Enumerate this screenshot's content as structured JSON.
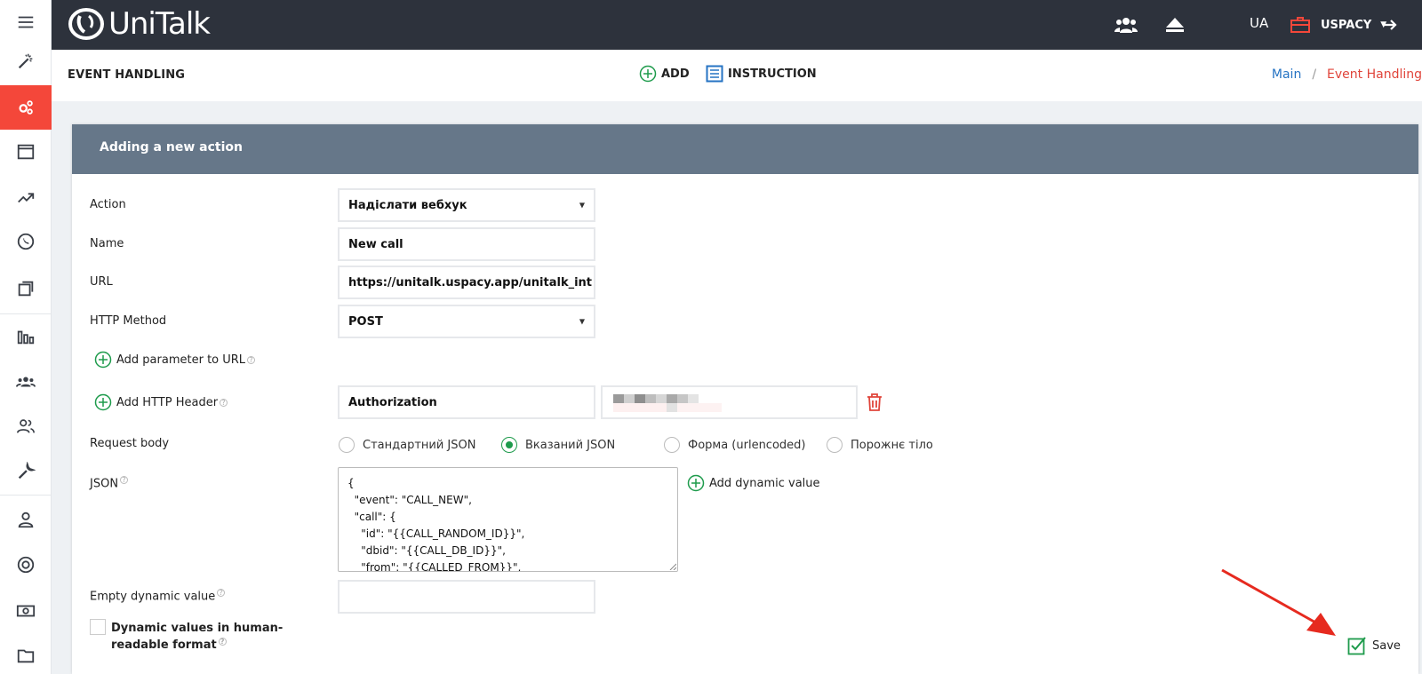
{
  "app": {
    "logo_text": "UniTalk"
  },
  "topbar": {
    "language": "UA",
    "organization": "USPACY"
  },
  "header": {
    "title": "EVENT HANDLING",
    "add_label": "ADD",
    "instruction_label": "INSTRUCTION",
    "breadcrumb": {
      "main": "Main",
      "separator": "/",
      "current": "Event Handling"
    }
  },
  "sidebar": {
    "items": [
      {
        "icon": "menu-icon"
      },
      {
        "icon": "magic-wand-icon"
      },
      {
        "icon": "gears-icon",
        "active": true
      },
      {
        "icon": "window-icon"
      },
      {
        "icon": "trend-icon"
      },
      {
        "icon": "phone-icon"
      },
      {
        "icon": "copy-icon"
      },
      {
        "icon": "bar-chart-icon"
      },
      {
        "icon": "group-icon"
      },
      {
        "icon": "users-icon"
      },
      {
        "icon": "wrench-icon"
      },
      {
        "icon": "user-icon"
      },
      {
        "icon": "lifebuoy-icon"
      },
      {
        "icon": "money-icon"
      },
      {
        "icon": "folder-icon"
      }
    ]
  },
  "card": {
    "title": "Adding a new action",
    "action": {
      "label": "Action",
      "value": "Надіслати вебхук"
    },
    "name": {
      "label": "Name",
      "value": "New call"
    },
    "url": {
      "label": "URL",
      "value": "https://unitalk.uspacy.app/unitalk_int"
    },
    "http_method": {
      "label": "HTTP Method",
      "value": "POST"
    },
    "add_param_label": "Add parameter to URL",
    "add_header_label": "Add HTTP Header",
    "header_key": "Authorization",
    "request_body": {
      "label": "Request body",
      "options": [
        "Стандартний JSON",
        "Вказаний JSON",
        "Форма (urlencoded)",
        "Порожнє тіло"
      ],
      "selected": "Вказаний JSON"
    },
    "json": {
      "label": "JSON",
      "value": "{\n  \"event\": \"CALL_NEW\",\n  \"call\": {\n    \"id\": \"{{CALL_RANDOM_ID}}\",\n    \"dbid\": \"{{CALL_DB_ID}}\",\n    \"from\": \"{{CALLED_FROM}}\","
    },
    "add_dynamic_label": "Add dynamic value",
    "empty_dynamic": {
      "label": "Empty dynamic value",
      "value": ""
    },
    "human_readable_label": "Dynamic values in human-readable format",
    "save_label": "Save"
  },
  "colors": {
    "accent_red": "#f4473a",
    "topbar": "#2d323c",
    "card_header": "#667789",
    "green": "#1e9b4c",
    "link_blue": "#2573c3"
  }
}
